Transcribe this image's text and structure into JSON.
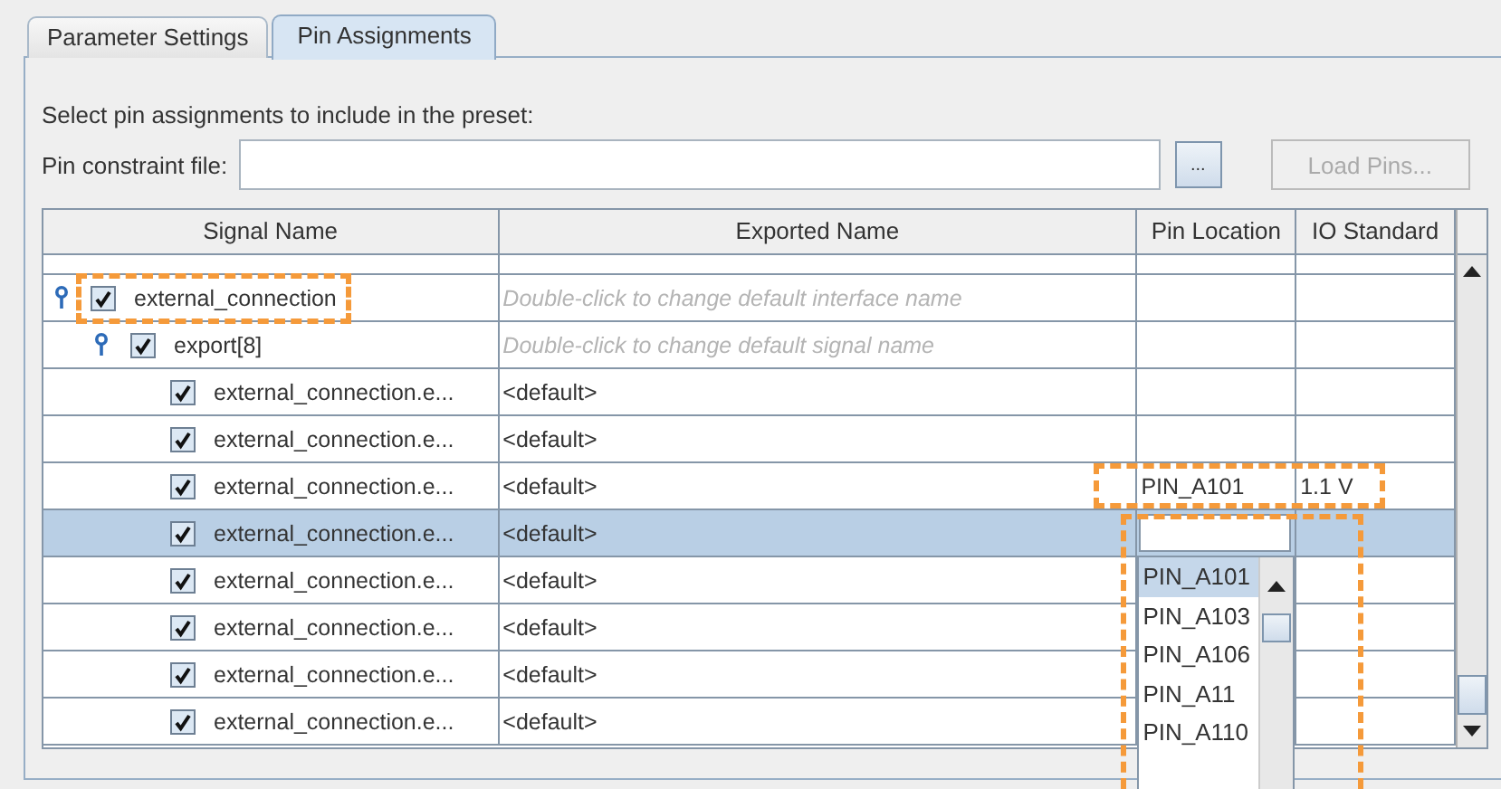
{
  "tabs": [
    {
      "label": "Parameter Settings",
      "selected": false
    },
    {
      "label": "Pin Assignments",
      "selected": true
    }
  ],
  "prompt": "Select pin assignments to include in the preset:",
  "pin_constraint_file": {
    "label": "Pin constraint file:"
  },
  "browse_button": "...",
  "load_button": {
    "label": "Load Pins...",
    "disabled": true
  },
  "table": {
    "columns": [
      "Signal Name",
      "Exported Name",
      "Pin Location",
      "IO Standard"
    ],
    "rows": [
      {
        "signal": "external_connection",
        "checked": true,
        "exported_placeholder": "Double-click to change default interface name",
        "selected": false,
        "highlighted": true,
        "children": [
          {
            "signal": "export[8]",
            "checked": true,
            "exported_placeholder": "Double-click to change default signal name",
            "selected": false,
            "children": [
              {
                "signal": "external_connection.e...",
                "checked": true,
                "exported": "<default>",
                "selected": false
              },
              {
                "signal": "external_connection.e...",
                "checked": true,
                "exported": "<default>",
                "selected": false
              },
              {
                "signal": "external_connection.e...",
                "checked": true,
                "exported": "<default>",
                "pin_location": "PIN_A101",
                "io_standard": "1.1 V",
                "selected": false,
                "highlighted": true
              },
              {
                "signal": "external_connection.e...",
                "checked": true,
                "exported": "<default>",
                "selected": true,
                "editor": {
                  "highlighted": true,
                  "options": [
                    {
                      "label": "PIN_A101",
                      "selected": true
                    },
                    {
                      "label": "PIN_A103",
                      "selected": false
                    },
                    {
                      "label": "PIN_A106",
                      "selected": false
                    },
                    {
                      "label": "PIN_A11",
                      "selected": false
                    },
                    {
                      "label": "PIN_A110",
                      "selected": false
                    }
                  ]
                }
              },
              {
                "signal": "external_connection.e...",
                "checked": true,
                "exported": "<default>",
                "selected": false
              },
              {
                "signal": "external_connection.e...",
                "checked": true,
                "exported": "<default>",
                "selected": false
              },
              {
                "signal": "external_connection.e...",
                "checked": true,
                "exported": "<default>",
                "selected": false
              },
              {
                "signal": "external_connection.e...",
                "checked": true,
                "exported": "<default>",
                "selected": false
              }
            ]
          }
        ]
      }
    ]
  }
}
